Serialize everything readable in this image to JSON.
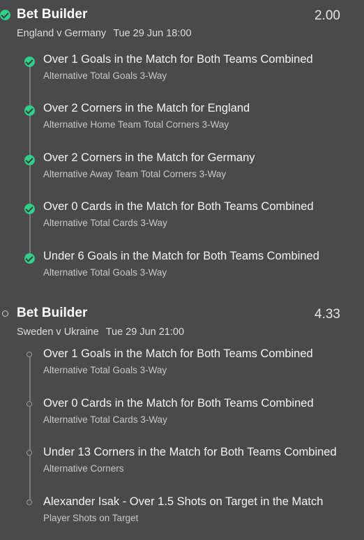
{
  "colors": {
    "background": "#4a4a4a",
    "settled_check": "#2fd08a",
    "timeline": "#7a7a7a"
  },
  "bets": [
    {
      "status": "settled",
      "status_icon": "check-circle-icon",
      "title": "Bet Builder",
      "odds": "2.00",
      "match": "England v Germany",
      "datetime": "Tue 29 Jun 18:00",
      "legs": [
        {
          "status": "settled",
          "icon": "check-circle-icon",
          "selection": "Over 1 Goals in the Match for Both Teams Combined",
          "market": "Alternative Total Goals 3-Way"
        },
        {
          "status": "settled",
          "icon": "check-circle-icon",
          "selection": "Over 2 Corners in the Match for England",
          "market": "Alternative Home Team Total Corners 3-Way"
        },
        {
          "status": "settled",
          "icon": "check-circle-icon",
          "selection": "Over 2 Corners in the Match for Germany",
          "market": "Alternative Away Team Total Corners 3-Way"
        },
        {
          "status": "settled",
          "icon": "check-circle-icon",
          "selection": "Over 0 Cards in the Match for Both Teams Combined",
          "market": "Alternative Total Cards 3-Way"
        },
        {
          "status": "settled",
          "icon": "check-circle-icon",
          "selection": "Under 6 Goals in the Match for Both Teams Combined",
          "market": "Alternative Total Goals 3-Way"
        }
      ]
    },
    {
      "status": "pending",
      "status_icon": "open-circle-icon",
      "title": "Bet Builder",
      "odds": "4.33",
      "match": "Sweden v Ukraine",
      "datetime": "Tue 29 Jun 21:00",
      "legs": [
        {
          "status": "pending",
          "icon": "open-circle-icon",
          "selection": "Over 1 Goals in the Match for Both Teams Combined",
          "market": "Alternative Total Goals 3-Way"
        },
        {
          "status": "pending",
          "icon": "open-circle-icon",
          "selection": "Over 0 Cards in the Match for Both Teams Combined",
          "market": "Alternative Total Cards 3-Way"
        },
        {
          "status": "pending",
          "icon": "open-circle-icon",
          "selection": "Under 13 Corners in the Match for Both Teams Combined",
          "market": "Alternative Corners"
        },
        {
          "status": "pending",
          "icon": "open-circle-icon",
          "selection": "Alexander Isak - Over 1.5 Shots on Target in the Match",
          "market": "Player Shots on Target"
        }
      ]
    }
  ]
}
